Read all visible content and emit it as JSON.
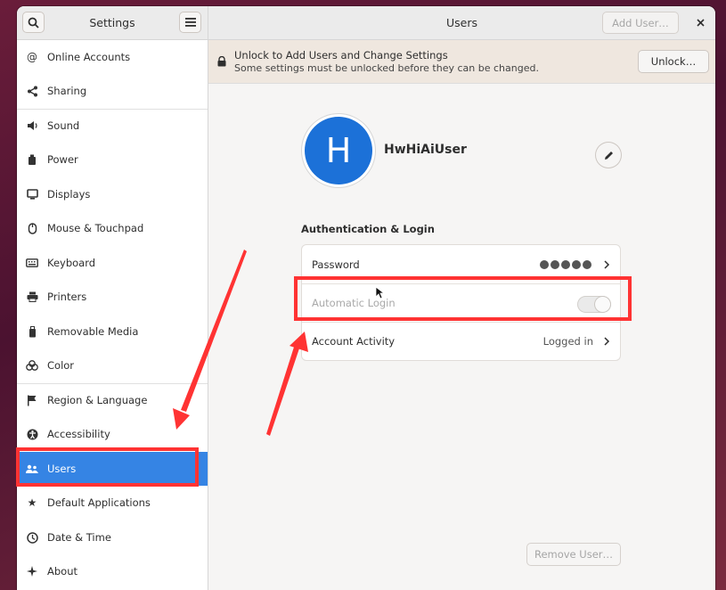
{
  "sidebar": {
    "title": "Settings",
    "search_icon": "search-icon",
    "menu_icon": "hamburger-menu-icon",
    "items": [
      {
        "label": "Online Accounts",
        "icon": "at-sign-icon"
      },
      {
        "label": "Sharing",
        "icon": "share-icon"
      },
      {
        "label": "Sound",
        "icon": "speaker-icon"
      },
      {
        "label": "Power",
        "icon": "power-icon"
      },
      {
        "label": "Displays",
        "icon": "display-icon"
      },
      {
        "label": "Mouse & Touchpad",
        "icon": "mouse-icon"
      },
      {
        "label": "Keyboard",
        "icon": "keyboard-icon"
      },
      {
        "label": "Printers",
        "icon": "printer-icon"
      },
      {
        "label": "Removable Media",
        "icon": "usb-drive-icon"
      },
      {
        "label": "Color",
        "icon": "color-circles-icon"
      },
      {
        "label": "Region & Language",
        "icon": "flag-icon"
      },
      {
        "label": "Accessibility",
        "icon": "accessibility-icon"
      },
      {
        "label": "Users",
        "icon": "users-icon"
      },
      {
        "label": "Default Applications",
        "icon": "star-icon"
      },
      {
        "label": "Date & Time",
        "icon": "clock-icon"
      },
      {
        "label": "About",
        "icon": "sparkle-icon"
      }
    ],
    "active_item": "Users"
  },
  "header": {
    "title": "Users",
    "add_user_label": "Add User…",
    "close_icon": "close-icon"
  },
  "infobar": {
    "title": "Unlock to Add Users and Change Settings",
    "subtitle": "Some settings must be unlocked before they can be changed.",
    "unlock_label": "Unlock…"
  },
  "user": {
    "avatar_letter": "H",
    "name": "HwHiAiUser"
  },
  "auth": {
    "section_title": "Authentication & Login",
    "password_label": "Password",
    "password_dots": 5,
    "auto_login_label": "Automatic Login",
    "auto_login_enabled": false,
    "activity_label": "Account Activity",
    "activity_value": "Logged in"
  },
  "remove_user_label": "Remove User…",
  "colors": {
    "accent": "#3584e4",
    "avatar": "#1c71d8",
    "annotation": "#ff3333",
    "infobar": "#efe7df"
  }
}
